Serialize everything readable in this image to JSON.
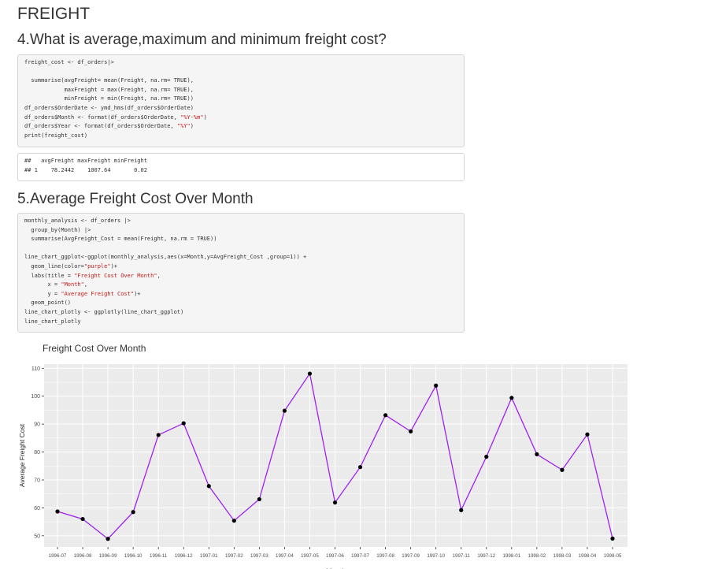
{
  "page_title": "FREIGHT",
  "section4": {
    "heading": "4.What is average,maximum and minimum freight cost?",
    "code_lines": [
      "freight_cost <- df_orders|>",
      "",
      "  summarise(avgFreight= mean(Freight, na.rm= TRUE),",
      "            maxFreight = max(Freight, na.rm= TRUE),",
      "            minFreight = min(Freight, na.rm= TRUE))",
      "df_orders$OrderDate <- ymd_hms(df_orders$OrderDate)",
      "df_orders$Month <- format(df_orders$OrderDate, \"%Y-%m\")",
      "df_orders$Year <- format(df_orders$OrderDate, \"%Y\")",
      "print(freight_cost)"
    ],
    "output_lines": [
      "##   avgFreight maxFreight minFreight",
      "## 1    78.2442    1007.64       0.02"
    ]
  },
  "section5": {
    "heading": "5.Average Freight Cost Over Month",
    "code_lines": [
      "monthly_analysis <- df_orders |>",
      "  group_by(Month) |>",
      "  summarise(AvgFreight_Cost = mean(Freight, na.rm = TRUE))",
      "",
      "line_chart_ggplot<-ggplot(monthly_analysis,aes(x=Month,y=AvgFreight_Cost ,group=1)) +",
      "  geom_line(color=\"purple\")+",
      "  labs(title = \"Freight Cost Over Month\",",
      "       x = \"Month\",",
      "       y = \"Average Freight Cost\")+",
      "  geom_point()",
      "line_chart_plotly <- ggplotly(line_chart_ggplot)",
      "line_chart_plotly"
    ]
  },
  "chart_data": {
    "type": "line",
    "title": "Freight Cost Over Month",
    "xlabel": "Month",
    "ylabel": "Average Freight Cost",
    "categories": [
      "1996-07",
      "1996-08",
      "1996-09",
      "1996-10",
      "1996-11",
      "1996-12",
      "1997-01",
      "1997-02",
      "1997-03",
      "1997-04",
      "1997-05",
      "1997-06",
      "1997-07",
      "1997-08",
      "1997-09",
      "1997-10",
      "1997-11",
      "1997-12",
      "1998-01",
      "1998-02",
      "1998-03",
      "1998-04",
      "1998-05"
    ],
    "values": [
      58.7,
      56.0,
      48.9,
      58.5,
      86.1,
      90.3,
      67.8,
      55.4,
      63.1,
      94.8,
      108.1,
      61.9,
      74.6,
      93.2,
      87.4,
      103.8,
      59.2,
      78.3,
      99.4,
      79.2,
      73.6,
      86.3,
      49.0
    ],
    "yticks": [
      50,
      60,
      70,
      80,
      90,
      100,
      110
    ],
    "ylim": [
      46,
      111.5
    ],
    "line_color": "#a020f0",
    "point_color": "#000000",
    "panel_bg": "#ebebeb",
    "grid_color": "#ffffff",
    "grid": true
  }
}
